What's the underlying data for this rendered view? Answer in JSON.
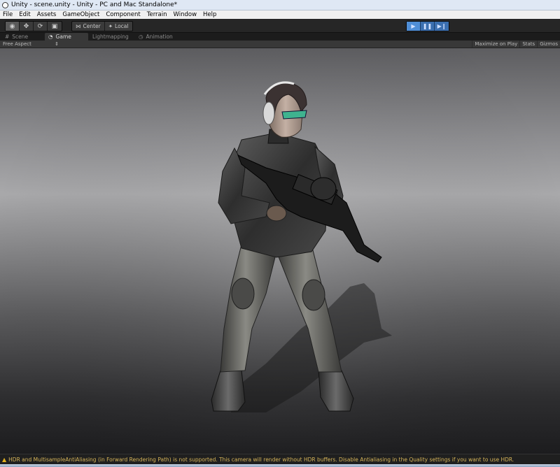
{
  "window": {
    "title": "Unity - scene.unity - Unity - PC and Mac Standalone*"
  },
  "menu": [
    {
      "label": "File"
    },
    {
      "label": "Edit"
    },
    {
      "label": "Assets"
    },
    {
      "label": "GameObject"
    },
    {
      "label": "Component"
    },
    {
      "label": "Terrain"
    },
    {
      "label": "Window"
    },
    {
      "label": "Help"
    }
  ],
  "toolbar": {
    "pivot_label": "Center",
    "space_label": "Local"
  },
  "tabs": [
    {
      "label": "Scene",
      "active": false
    },
    {
      "label": "Game",
      "active": true
    },
    {
      "label": "Lightmapping",
      "active": false
    },
    {
      "label": "Animation",
      "active": false
    }
  ],
  "game_view": {
    "aspect": "Free Aspect",
    "maximize_on_play": "Maximize on Play",
    "stats": "Stats",
    "gizmos": "Gizmos"
  },
  "status": {
    "message": "HDR and MultisampleAntiAliasing (in Forward Rendering Path) is not supported. This camera will render without HDR buffers. Disable Antialiasing in the Quality settings if you want to use HDR."
  },
  "colors": {
    "play_active": "#4f8ed6",
    "warning_text": "#d8b65a"
  }
}
